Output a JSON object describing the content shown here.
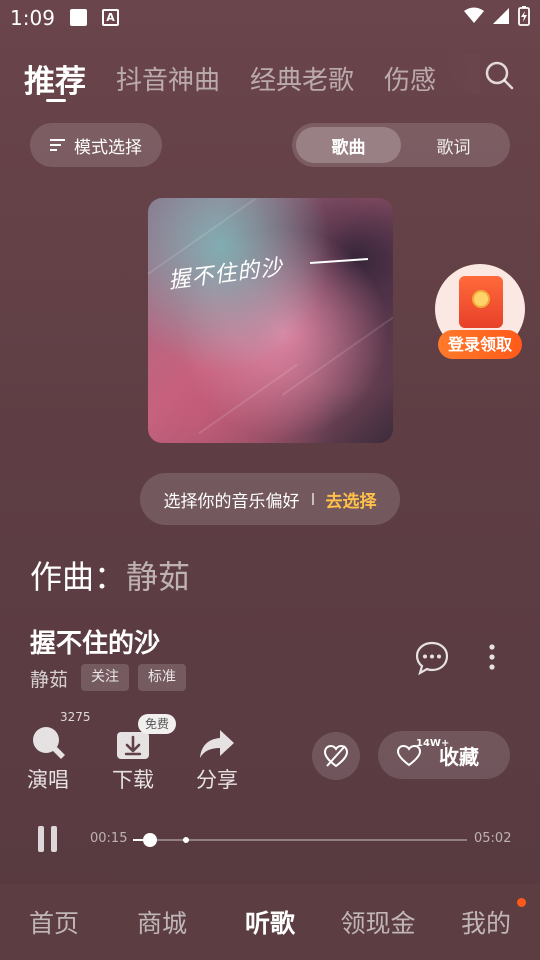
{
  "status_bar": {
    "time": "1:09",
    "notification_icon_text": "A",
    "icons": [
      "stop-icon",
      "translate-icon",
      "wifi-icon",
      "signal-icon",
      "battery-charging-icon"
    ]
  },
  "top_tabs": [
    {
      "label": "推荐",
      "active": true
    },
    {
      "label": "抖音神曲",
      "active": false
    },
    {
      "label": "经典老歌",
      "active": false
    },
    {
      "label": "伤感",
      "active": false
    }
  ],
  "mode_select": {
    "label": "模式选择",
    "icon": "filter-lines-icon"
  },
  "view_toggle": {
    "options": [
      "歌曲",
      "歌词"
    ],
    "selected": "歌曲"
  },
  "cover": {
    "title_text": "握不住的沙"
  },
  "red_packet": {
    "label": "登录领取"
  },
  "preference": {
    "text": "选择你的音乐偏好",
    "link": "去选择"
  },
  "composer": {
    "label": "作曲：",
    "name": "静茹"
  },
  "song": {
    "title": "握不住的沙",
    "artist": "静茹",
    "tags": [
      "关注",
      "标准"
    ]
  },
  "actions": {
    "sing": {
      "label": "演唱",
      "count": "3275"
    },
    "download": {
      "label": "下载",
      "badge": "免费"
    },
    "share": {
      "label": "分享"
    },
    "favorite": {
      "label": "收藏",
      "count": "14W+"
    }
  },
  "player": {
    "current_time": "00:15",
    "total_time": "05:02",
    "progress_fraction": 0.05,
    "buffer_marker_fraction": 0.16,
    "state": "playing"
  },
  "bottom_nav": [
    {
      "label": "首页",
      "active": false
    },
    {
      "label": "商城",
      "active": false
    },
    {
      "label": "听歌",
      "active": true
    },
    {
      "label": "领现金",
      "active": false
    },
    {
      "label": "我的",
      "active": false,
      "dot": true
    }
  ],
  "colors": {
    "background": "#6a454b",
    "accent_link": "#ffc04a",
    "red_packet": "#ff5a1a"
  }
}
